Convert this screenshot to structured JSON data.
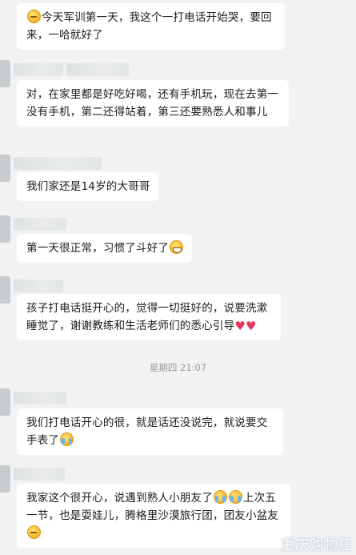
{
  "messages": [
    {
      "text_before": "",
      "emoji_start": "thinking-face",
      "text": "今天军训第一天，我这个一打电话开始哭，要回来，一哈就好了"
    },
    {
      "text": "对，在家里都是好吃好喝，还有手机玩，现在去第一没有手机，第二还得站着，第三还要熟悉人和事儿"
    },
    {
      "text": "我们家还是14岁的大哥哥"
    },
    {
      "text": "第一天很正常，习惯了斗好了",
      "emoji_end": "grinning-face"
    },
    {
      "text": "孩子打电话挺开心的，觉得一切挺好的，说要洗漱睡觉了，谢谢教练和生活老师们的悉心引导",
      "emoji_end": "hearts"
    },
    {
      "text": "我们打电话开心的很，就是话还没说完，就说要交手表了",
      "emoji_end": "laughing-crying-face"
    },
    {
      "text_a": "我家这个很开心，说遇到熟人小朋友了",
      "text_b": "上次五一节，也是耍娃儿，腾格里沙漠旅行团，团友小盆友",
      "emoji_mid": "laughing-crying-face",
      "emoji_end": "thinking-face"
    }
  ],
  "timestamp": "星期四 21:07",
  "watermark": "重庆购物狂"
}
